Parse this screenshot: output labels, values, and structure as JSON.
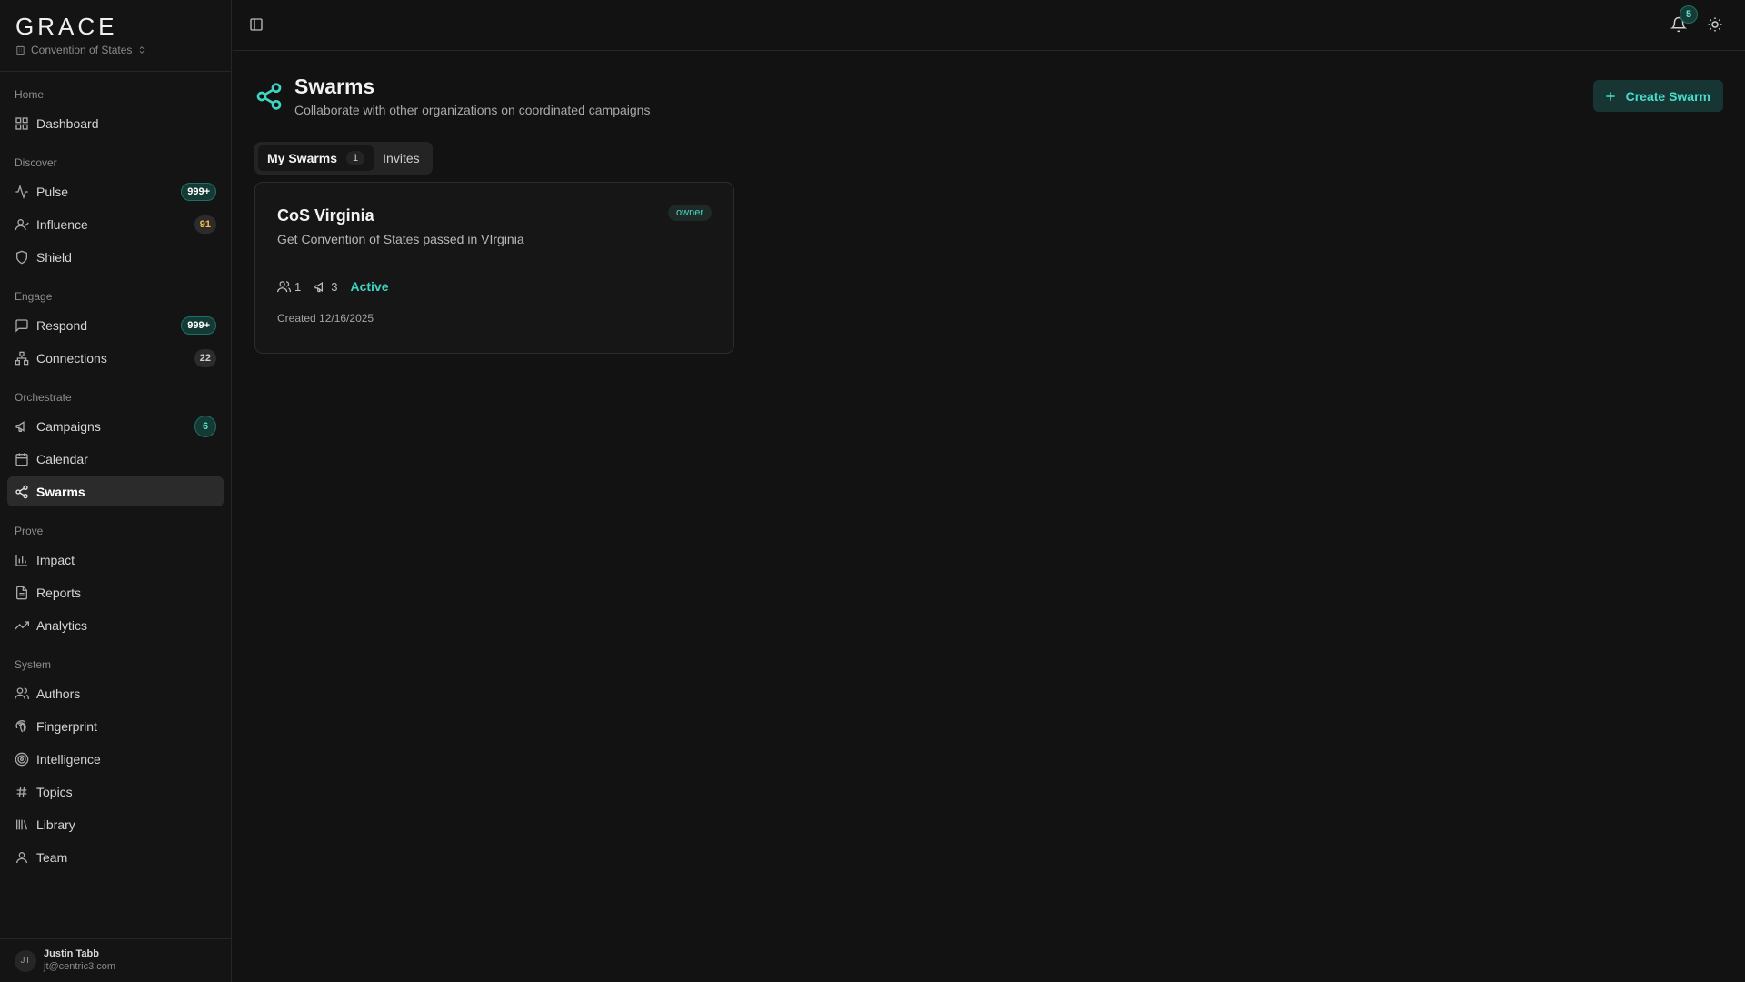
{
  "app": {
    "logo": "GRACE",
    "org": "Convention of States"
  },
  "sidebar": {
    "sections": [
      {
        "label": "Home",
        "items": [
          {
            "label": "Dashboard",
            "icon": "dashboard-icon"
          }
        ]
      },
      {
        "label": "Discover",
        "items": [
          {
            "label": "Pulse",
            "icon": "activity-icon",
            "badge": "999+"
          },
          {
            "label": "Influence",
            "icon": "user-icon",
            "badge": "91"
          },
          {
            "label": "Shield",
            "icon": "shield-icon"
          }
        ]
      },
      {
        "label": "Engage",
        "items": [
          {
            "label": "Respond",
            "icon": "message-icon",
            "badge": "999+"
          },
          {
            "label": "Connections",
            "icon": "network-icon",
            "badge": "22"
          }
        ]
      },
      {
        "label": "Orchestrate",
        "items": [
          {
            "label": "Campaigns",
            "icon": "megaphone-icon",
            "badge": "6"
          },
          {
            "label": "Calendar",
            "icon": "calendar-icon"
          },
          {
            "label": "Swarms",
            "icon": "share-icon",
            "active": true
          }
        ]
      },
      {
        "label": "Prove",
        "items": [
          {
            "label": "Impact",
            "icon": "bar-chart-icon"
          },
          {
            "label": "Reports",
            "icon": "file-text-icon"
          },
          {
            "label": "Analytics",
            "icon": "trending-up-icon"
          }
        ]
      },
      {
        "label": "System",
        "items": [
          {
            "label": "Authors",
            "icon": "users-icon"
          },
          {
            "label": "Fingerprint",
            "icon": "fingerprint-icon"
          },
          {
            "label": "Intelligence",
            "icon": "target-icon"
          },
          {
            "label": "Topics",
            "icon": "hash-icon"
          },
          {
            "label": "Library",
            "icon": "library-icon"
          },
          {
            "label": "Team",
            "icon": "team-icon"
          }
        ]
      }
    ],
    "user": {
      "initials": "JT",
      "name": "Justin Tabb",
      "email": "jt@centric3.com"
    }
  },
  "topbar": {
    "notification_count": "5"
  },
  "page": {
    "title": "Swarms",
    "subtitle": "Collaborate with other organizations on coordinated campaigns",
    "create_button": "Create Swarm",
    "tabs": [
      {
        "label": "My Swarms",
        "count": "1"
      },
      {
        "label": "Invites"
      }
    ]
  },
  "swarms": [
    {
      "name": "CoS Virginia",
      "role": "owner",
      "description": "Get Convention of States passed in VIrginia",
      "members": "1",
      "campaigns": "3",
      "status": "Active",
      "created": "Created 12/16/2025"
    }
  ],
  "colors": {
    "accent": "#3fd4c2",
    "background": "#121212",
    "sidebar": "#141414",
    "amber": "#f2b84b"
  }
}
